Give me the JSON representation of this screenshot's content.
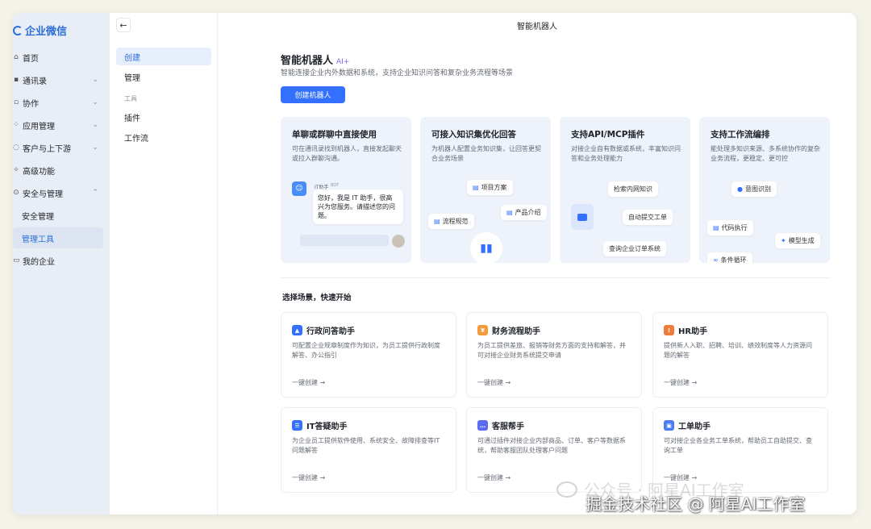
{
  "sidebar": {
    "logo": "企业微信",
    "items": [
      {
        "label": "首页",
        "icon": "home-icon",
        "glyph": "⌂",
        "chevron": ""
      },
      {
        "label": "通讯录",
        "icon": "contacts-icon",
        "glyph": "▪",
        "chevron": "⌄"
      },
      {
        "label": "协作",
        "icon": "collab-icon",
        "glyph": "▫",
        "chevron": "⌄"
      },
      {
        "label": "应用管理",
        "icon": "apps-icon",
        "glyph": "⁘",
        "chevron": "⌄"
      },
      {
        "label": "客户与上下游",
        "icon": "customer-icon",
        "glyph": "◌",
        "chevron": "⌄"
      },
      {
        "label": "高级功能",
        "icon": "advanced-icon",
        "glyph": "✧",
        "chevron": ""
      },
      {
        "label": "安全与管理",
        "icon": "security-icon",
        "glyph": "⊙",
        "chevron": "⌃"
      },
      {
        "label": "安全管理",
        "icon": "",
        "glyph": "",
        "chevron": ""
      },
      {
        "label": "管理工具",
        "icon": "",
        "glyph": "",
        "chevron": ""
      },
      {
        "label": "我的企业",
        "icon": "company-icon",
        "glyph": "▭",
        "chevron": ""
      }
    ]
  },
  "subnav": {
    "back": "←",
    "create": "创建",
    "manage": "管理",
    "group_tools": "工具",
    "plugins": "插件",
    "workflow": "工作流"
  },
  "header": {
    "window_title": "智能机器人",
    "title": "智能机器人",
    "ai_tag": "AI+",
    "description": "智能连接企业内外数据和系统，支持企业知识问答和复杂业务流程等场景",
    "create_button": "创建机器人"
  },
  "features": [
    {
      "title": "单聊或群聊中直接使用",
      "desc": "可在通讯录找到机器人，直接发起聊天或拉入群聊沟通。"
    },
    {
      "title": "可接入知识集优化回答",
      "desc": "为机器人配置业务知识集，让回答更契合业务场景"
    },
    {
      "title": "支持API/MCP插件",
      "desc": "对接企业自有数据或系统，丰富知识问答和业务处理能力"
    },
    {
      "title": "支持工作流编排",
      "desc": "能处理多知识来源、多系统协作的复杂业务流程，更稳定、更可控"
    }
  ],
  "feature_visuals": {
    "chat": {
      "bot_name": "IT助手",
      "bot_badge": "BOT",
      "message": "您好，我是 IT 助手，很高兴为您服务。请描述您的问题。"
    },
    "knowledge": [
      "项目方案",
      "产品介绍",
      "流程规范"
    ],
    "plugin": [
      "检索内网知识",
      "自动提交工单",
      "查询企业订单系统"
    ],
    "workflow": [
      "意图识别",
      "代码执行",
      "模型生成",
      "条件循环"
    ]
  },
  "scenes_title": "选择场景，快速开始",
  "scenes": [
    {
      "title": "行政问答助手",
      "icon": "admin-qa-icon",
      "color": "#3370ff",
      "desc": "可配置企业规章制度作为知识，为员工提供行政制度解答、办公指引",
      "link": "一键创建 →"
    },
    {
      "title": "财务流程助手",
      "icon": "finance-icon",
      "color": "#f29a3e",
      "desc": "为员工提供差旅、报销等财务方面的支持和解答，并可对接企业财务系统提交申请",
      "link": "一键创建 →"
    },
    {
      "title": "HR助手",
      "icon": "hr-icon",
      "color": "#f07b3f",
      "desc": "提供新人入职、招聘、培训、绩效制度等人力资源问题的解答",
      "link": "一键创建 →"
    },
    {
      "title": "IT答疑助手",
      "icon": "it-icon",
      "color": "#3370ff",
      "desc": "为企业员工提供软件使用、系统安全、故障排查等IT问题解答",
      "link": "一键创建 →"
    },
    {
      "title": "客服帮手",
      "icon": "service-icon",
      "color": "#5b6cf0",
      "desc": "可通过插件对接企业内部商品、订单、客户等数据系统，帮助客服团队处理客户问题",
      "link": "一键创建 →"
    },
    {
      "title": "工单助手",
      "icon": "ticket-icon",
      "color": "#4c7cf5",
      "desc": "可对接企业各业务工单系统，帮助员工自助提交、查询工单",
      "link": "一键创建 →"
    }
  ],
  "watermark": "公众号 · 阿星AI工作室",
  "credit": "掘金技术社区 @ 阿星AI工作室"
}
